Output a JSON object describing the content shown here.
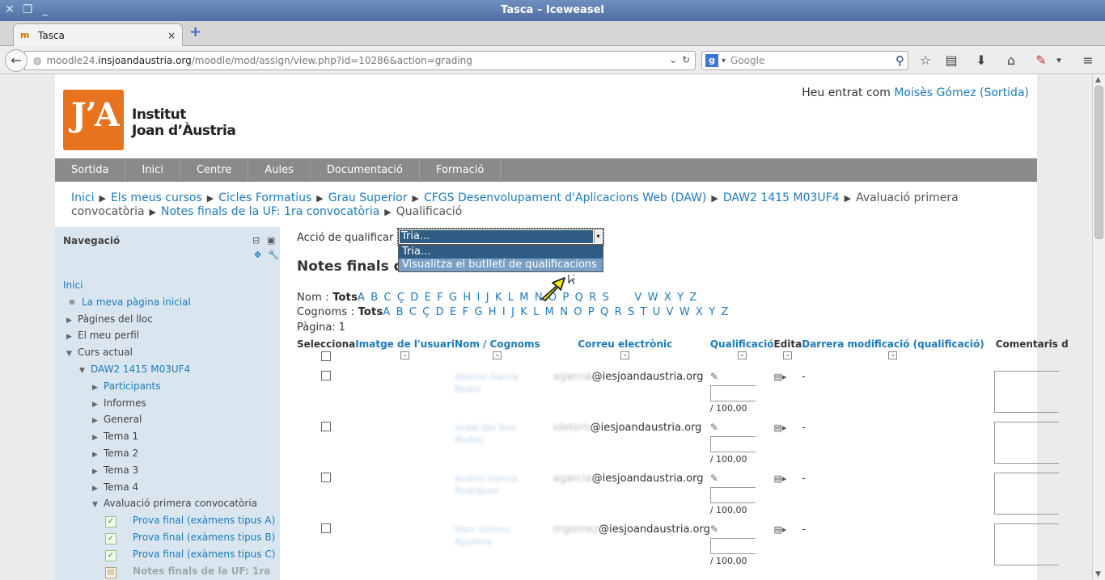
{
  "window": {
    "title": "Tasca – Iceweasel"
  },
  "browser": {
    "tab_label": "Tasca",
    "tab_close": "×",
    "new_tab": "+",
    "url_host_prefix": "moodle24.",
    "url_host": "insjoandaustria.org",
    "url_path": "/moodle/mod/assign/view.php?id=10286&action=grading",
    "search_placeholder": "Google"
  },
  "site": {
    "logo_letters": "JʼA",
    "logo_line1": "Institut",
    "logo_line2": "Joan d’Àustria",
    "login_prefix": "Heu entrat com ",
    "login_user": "Moisès Gómez",
    "login_open": " (",
    "login_logout": "Sortida",
    "login_close": ")"
  },
  "menu": [
    "Sortida",
    "Inici",
    "Centre",
    "Aules",
    "Documentació",
    "Formació"
  ],
  "breadcrumb": {
    "links": [
      "Inici",
      "Els meus cursos",
      "Cicles Formatius",
      "Grau Superior",
      "CFGS Desenvolupament d'Aplicacions Web (DAW)",
      "DAW2 1415 M03UF4"
    ],
    "plain": "Avaluació primera convocatòria",
    "link_last": "Notes finals de la UF: 1ra convocatòria",
    "current": "Qualificació",
    "sep": "▶"
  },
  "sidebar": {
    "title": "Navegació",
    "items": [
      {
        "label": "Inici",
        "kind": "link",
        "indent": 0,
        "marker": "none"
      },
      {
        "label": "La meva pàgina inicial",
        "kind": "link",
        "indent": 0,
        "marker": "bullet"
      },
      {
        "label": "Pàgines del lloc",
        "kind": "text",
        "indent": 0,
        "marker": "closed"
      },
      {
        "label": "El meu perfil",
        "kind": "text",
        "indent": 0,
        "marker": "closed"
      },
      {
        "label": "Curs actual",
        "kind": "text",
        "indent": 0,
        "marker": "open"
      },
      {
        "label": "DAW2 1415 M03UF4",
        "kind": "link",
        "indent": 1,
        "marker": "open"
      },
      {
        "label": "Participants",
        "kind": "link",
        "indent": 2,
        "marker": "closed"
      },
      {
        "label": "Informes",
        "kind": "text",
        "indent": 2,
        "marker": "closed"
      },
      {
        "label": "General",
        "kind": "text",
        "indent": 2,
        "marker": "closed"
      },
      {
        "label": "Tema 1",
        "kind": "text",
        "indent": 2,
        "marker": "closed"
      },
      {
        "label": "Tema 2",
        "kind": "text",
        "indent": 2,
        "marker": "closed"
      },
      {
        "label": "Tema 3",
        "kind": "text",
        "indent": 2,
        "marker": "closed"
      },
      {
        "label": "Tema 4",
        "kind": "text",
        "indent": 2,
        "marker": "closed"
      },
      {
        "label": "Avaluació primera convocatòria",
        "kind": "text",
        "indent": 2,
        "marker": "open"
      },
      {
        "label": "Prova final (exàmens tipus A)",
        "kind": "link",
        "indent": 3,
        "marker": "check"
      },
      {
        "label": "Prova final (exàmens tipus B)",
        "kind": "link",
        "indent": 3,
        "marker": "check"
      },
      {
        "label": "Prova final (exàmens tipus C)",
        "kind": "link",
        "indent": 3,
        "marker": "check"
      },
      {
        "label": "Notes finals de la UF: 1ra",
        "kind": "dim",
        "indent": 3,
        "marker": "doc"
      }
    ]
  },
  "main": {
    "grading_action_label": "Acció de qualificar",
    "grading_action_value": "Tria...",
    "dropdown_options": [
      "Tria...",
      "Visualitza el butlletí de qualificacions"
    ],
    "assignment_title": "Notes finals de",
    "first_name_label": "Nom : ",
    "last_name_label": "Cognoms : ",
    "all_label": "Tots",
    "first_name_letters": "A B C Ç D E F G H I J K L M N O P Q R S",
    "first_name_letters_tail": "V W X Y Z",
    "last_name_letters": "A B C Ç D E F G H I J K L M N O P Q R S T U V W X Y Z",
    "page_label": "Pàgina:  1",
    "columns": [
      "Selecciona",
      "Imatge de l'usuari",
      "Nom / Cognoms",
      "Correu electrònic",
      "Qualificació",
      "Edita",
      "Darrera modificació (qualificació)",
      "Comentaris d"
    ],
    "rows": [
      {
        "name_blur": "Alberto García Beato",
        "mail_blur": "agarcia",
        "mail_domain": "@iesjoandaustria.org",
        "out_of": "/ 100,00",
        "last_mod": "-"
      },
      {
        "name_blur": "Israel del Toro Muñoz",
        "mail_blur": "idetoro",
        "mail_domain": "@iesjoandaustria.org",
        "out_of": "/ 100,00",
        "last_mod": "-"
      },
      {
        "name_blur": "Andrés García Rodríguez",
        "mail_blur": "agarcia",
        "mail_domain": "@iesjoandaustria.org",
        "out_of": "/ 100,00",
        "last_mod": "-"
      },
      {
        "name_blur": "Marc Gómez Aguilera",
        "mail_blur": "mgomez",
        "mail_domain": "@iesjoandaustria.org",
        "out_of": "/ 100,00",
        "last_mod": "-"
      }
    ]
  },
  "colors": {
    "link": "#1d7ab8",
    "menubar": "#8a8a8a",
    "sidebar": "#d9e6ef",
    "logo": "#e8731f",
    "select_highlight": "#2f5c82"
  }
}
